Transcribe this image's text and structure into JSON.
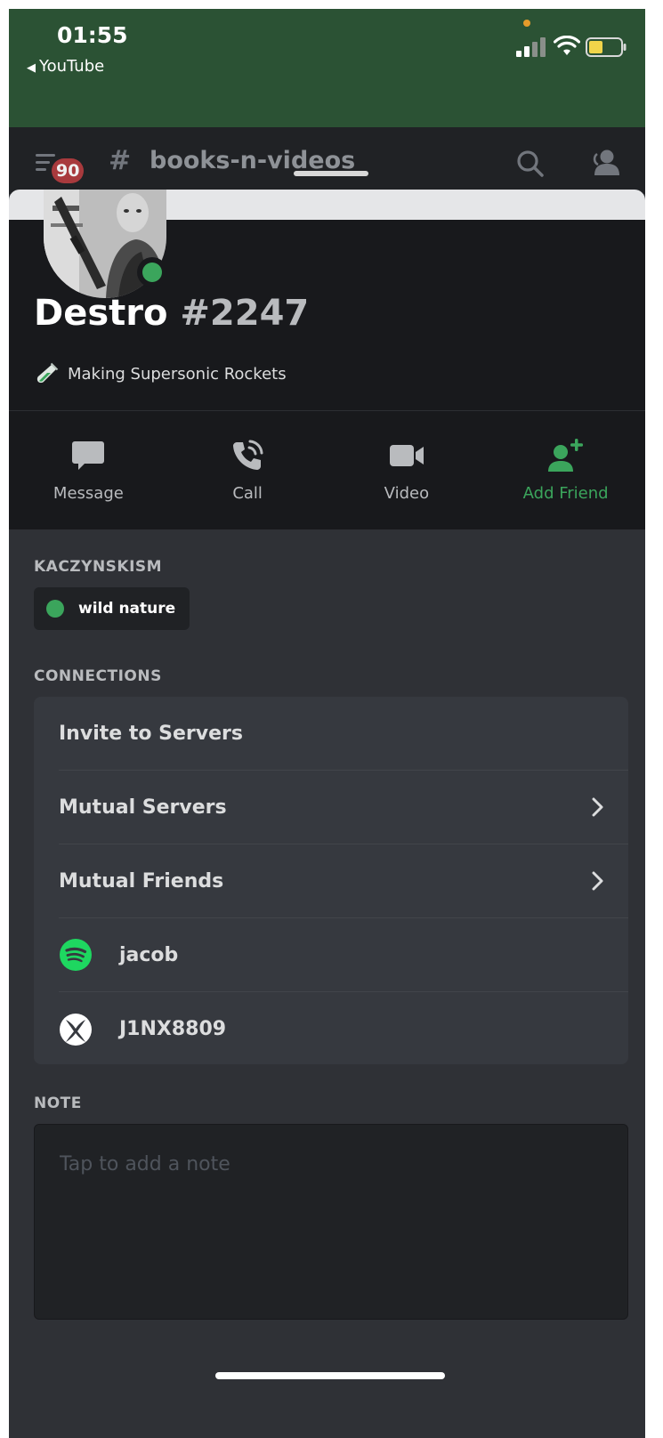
{
  "status_bar": {
    "time": "01:55",
    "back_app": "YouTube",
    "battery_color": "#f0d44a"
  },
  "channel_header": {
    "unread_badge": "90",
    "hash": "#",
    "channel_name": "books-n-videos"
  },
  "profile": {
    "username": "Destro",
    "discriminator": "#2247",
    "custom_status": "Making Supersonic Rockets",
    "presence_color": "#3ba55c"
  },
  "actions": [
    {
      "label": "Message",
      "icon": "chat-bubble-icon"
    },
    {
      "label": "Call",
      "icon": "phone-icon"
    },
    {
      "label": "Video",
      "icon": "video-camera-icon"
    },
    {
      "label": "Add Friend",
      "icon": "add-friend-icon"
    }
  ],
  "roles": {
    "title": "KACZYNSKISM",
    "items": [
      {
        "name": "wild nature",
        "color": "#3ba55c"
      }
    ]
  },
  "connections": {
    "title": "CONNECTIONS",
    "invite_label": "Invite to Servers",
    "mutual_servers_label": "Mutual Servers",
    "mutual_friends_label": "Mutual Friends",
    "accounts": [
      {
        "service": "spotify-icon",
        "name": "jacob"
      },
      {
        "service": "xbox-icon",
        "name": "J1NX8809"
      }
    ]
  },
  "note": {
    "title": "NOTE",
    "placeholder": "Tap to add a note"
  },
  "colors": {
    "accent_green": "#3ba55c",
    "status_bar_bg": "#2b5234",
    "badge_red": "#a83a3d"
  }
}
